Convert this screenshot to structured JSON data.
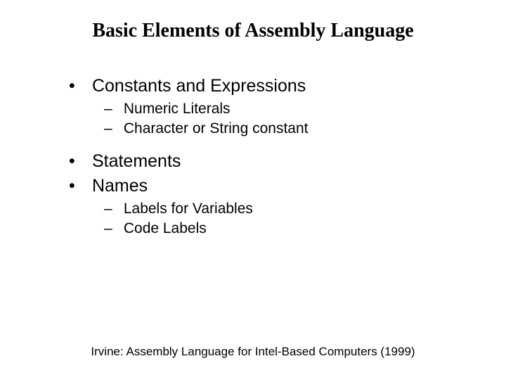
{
  "title": "Basic Elements of Assembly Language",
  "bullets": {
    "b1": "Constants and Expressions",
    "b1_sub1": "Numeric Literals",
    "b1_sub2": "Character or String constant",
    "b2": "Statements",
    "b3": "Names",
    "b3_sub1": "Labels for Variables",
    "b3_sub2": "Code Labels"
  },
  "footer": "Irvine: Assembly Language for Intel-Based Computers (1999)"
}
